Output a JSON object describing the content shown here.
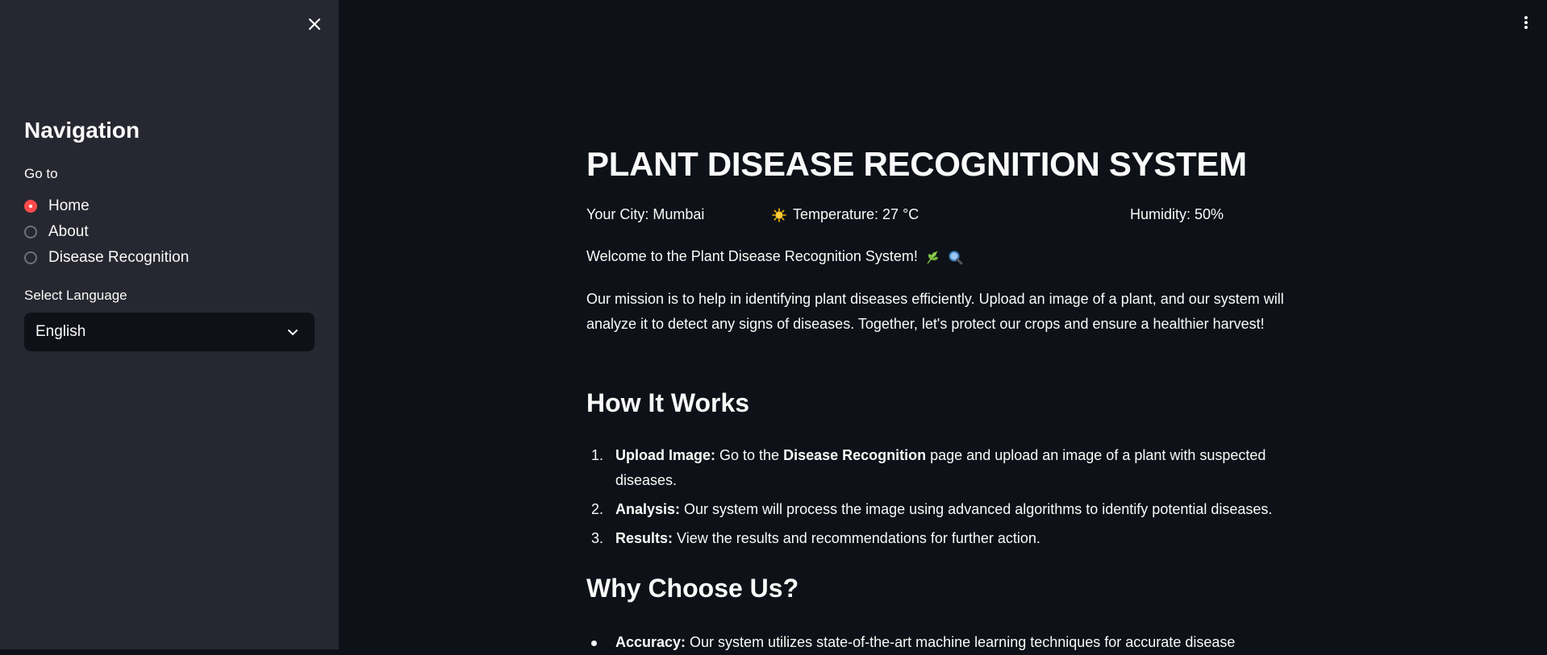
{
  "sidebar": {
    "title": "Navigation",
    "goto_label": "Go to",
    "nav_options": [
      {
        "label": "Home",
        "selected": true
      },
      {
        "label": "About",
        "selected": false
      },
      {
        "label": "Disease Recognition",
        "selected": false
      }
    ],
    "language_label": "Select Language",
    "language_value": "English"
  },
  "main": {
    "title": "PLANT DISEASE RECOGNITION SYSTEM",
    "weather": {
      "city": "Your City: Mumbai",
      "temperature": "Temperature: 27 °C",
      "humidity": "Humidity: 50%"
    },
    "welcome": "Welcome to the Plant Disease Recognition System!",
    "mission": "Our mission is to help in identifying plant diseases efficiently. Upload an image of a plant, and our system will analyze it to detect any signs of diseases. Together, let's protect our crops and ensure a healthier harvest!",
    "how_title": "How It Works",
    "steps": [
      {
        "num": "1.",
        "bold": "Upload Image:",
        "pre": " Go to the ",
        "bold2": "Disease Recognition",
        "text": " page and upload an image of a plant with suspected diseases."
      },
      {
        "num": "2.",
        "bold": "Analysis:",
        "text": " Our system will process the image using advanced algorithms to identify potential diseases."
      },
      {
        "num": "3.",
        "bold": "Results:",
        "text": " View the results and recommendations for further action."
      }
    ],
    "why_title": "Why Choose Us?",
    "reasons": [
      {
        "bold": "Accuracy:",
        "text": " Our system utilizes state-of-the-art machine learning techniques for accurate disease"
      }
    ]
  },
  "icons": {
    "close": "close-icon",
    "menu": "more-vertical-icon",
    "chevron": "chevron-down-icon",
    "sun": "sun-emoji-icon",
    "herb": "herb-emoji-icon",
    "magnifier": "magnifying-glass-emoji-icon"
  },
  "colors": {
    "background": "#0e1117",
    "sidebar": "#262730",
    "accent": "#ff4b4b",
    "text": "#fafafa"
  }
}
